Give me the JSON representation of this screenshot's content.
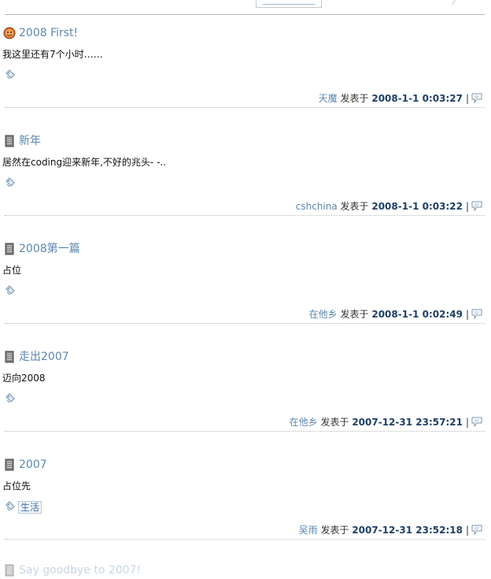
{
  "posts": [
    {
      "title": "2008 First!",
      "icon": "smiley-face-icon",
      "body": "我这里还有7个小时……",
      "tag": "",
      "author": "天魔",
      "posted_label": "发表于",
      "date": "2008-1-1 0:03:27",
      "separator": "|"
    },
    {
      "title": "新年",
      "icon": "document-icon",
      "body": "居然在coding迎来新年,不好的兆头- -..",
      "tag": "",
      "author": "cshchina",
      "posted_label": "发表于",
      "date": "2008-1-1 0:03:22",
      "separator": "|"
    },
    {
      "title": "2008第一篇",
      "icon": "document-icon",
      "body": "占位",
      "tag": "",
      "author": "在他乡",
      "posted_label": "发表于",
      "date": "2008-1-1 0:02:49",
      "separator": "|"
    },
    {
      "title": "走出2007",
      "icon": "document-icon",
      "body": "迈向2008",
      "tag": "",
      "author": "在他乡",
      "posted_label": "发表于",
      "date": "2007-12-31 23:57:21",
      "separator": "|"
    },
    {
      "title": "2007",
      "icon": "document-icon",
      "body": "占位先",
      "tag": "生活",
      "author": "吴雨",
      "posted_label": "发表于",
      "date": "2007-12-31 23:52:18",
      "separator": "|"
    }
  ],
  "next_post_title": "Say goodbye to 2007!",
  "colors": {
    "title_link": "#5b86b0",
    "date": "#1e3f66",
    "separator_line": "#bcbcbc"
  }
}
